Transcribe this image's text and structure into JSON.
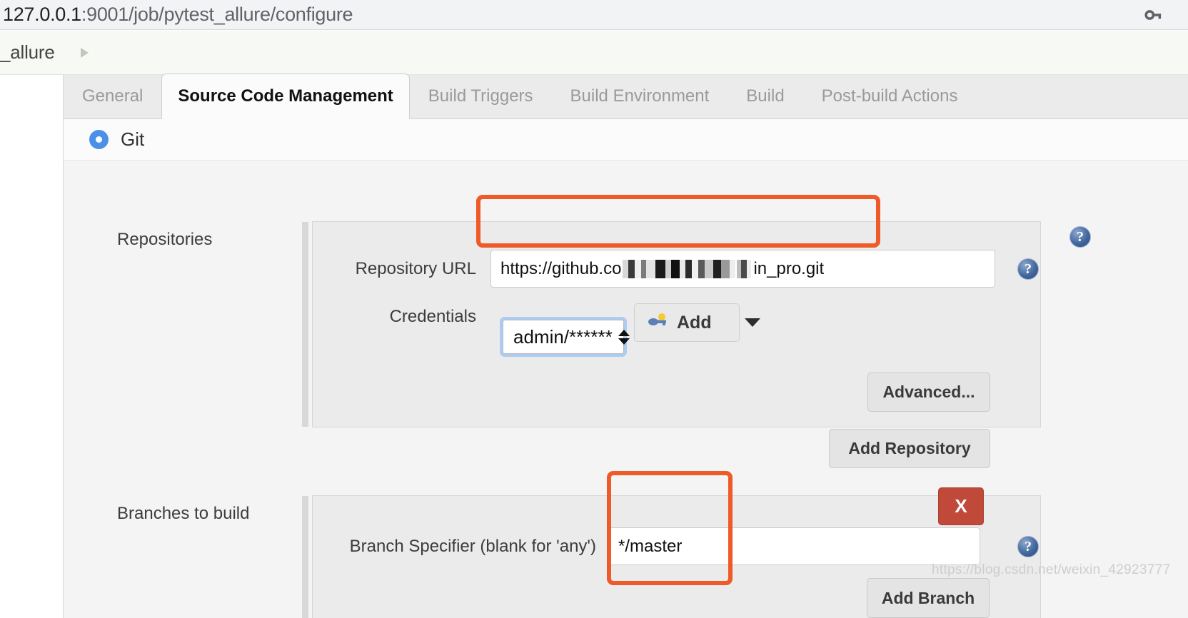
{
  "browser": {
    "url_host": "127.0.0.1",
    "url_path": ":9001/job/pytest_allure/configure",
    "key_icon_name": "saved-password-key-icon"
  },
  "breadcrumb": {
    "item": "_allure",
    "arrow": "▶"
  },
  "tabs": [
    {
      "label": "General",
      "active": false
    },
    {
      "label": "Source Code Management",
      "active": true
    },
    {
      "label": "Build Triggers",
      "active": false
    },
    {
      "label": "Build Environment",
      "active": false
    },
    {
      "label": "Build",
      "active": false
    },
    {
      "label": "Post-build Actions",
      "active": false
    }
  ],
  "scm": {
    "radio_label": "Git",
    "radio_selected": true
  },
  "repositories": {
    "section_label": "Repositories",
    "url_field": {
      "label": "Repository URL",
      "value_prefix": "https://github.co",
      "value_suffix": "in_pro.git",
      "redacted": true
    },
    "credentials": {
      "label": "Credentials",
      "selected": "admin/******",
      "add_button": "Add"
    },
    "advanced_button": "Advanced...",
    "add_repository_button": "Add Repository"
  },
  "branches": {
    "section_label": "Branches to build",
    "specifier": {
      "label": "Branch Specifier (blank for 'any')",
      "value": "*/master"
    },
    "delete_button": "X",
    "add_branch_button": "Add Branch"
  },
  "help": {
    "glyph": "?"
  },
  "watermark": "https://blog.csdn.net/weixin_42923777",
  "colors": {
    "accent_annotation": "#ef5b28",
    "radio_blue": "#4a90e8",
    "delete_red": "#c0493a",
    "focus_ring": "#aecbf2"
  }
}
